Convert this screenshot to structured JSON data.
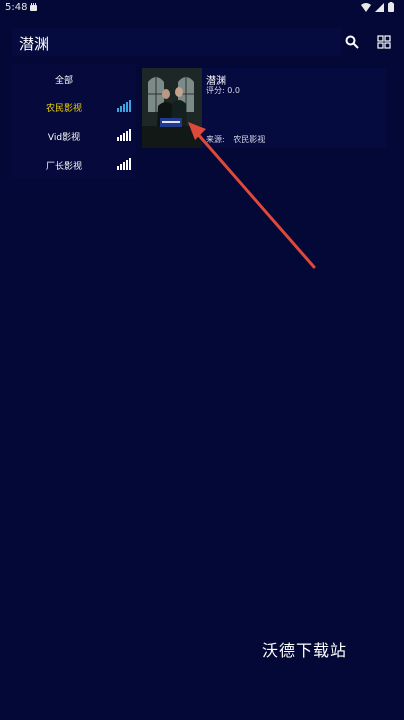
{
  "status_bar": {
    "time": "5:48"
  },
  "header": {
    "title": "潜渊"
  },
  "sidebar": {
    "items": [
      {
        "label": "全部"
      },
      {
        "label": "农民影视"
      },
      {
        "label": "Vid影视"
      },
      {
        "label": "厂长影视"
      }
    ],
    "active_index": 1
  },
  "result": {
    "title": "潜渊",
    "score": "评分: 0.0",
    "source_label": "来源:",
    "source_value": "农民影视"
  },
  "watermark": "沃德下载站",
  "colors": {
    "background": "#030836",
    "active_text": "#f0d400",
    "arrow": "#e0483a",
    "signal_active": "#3aa3e0",
    "signal_idle": "#ffffff"
  }
}
